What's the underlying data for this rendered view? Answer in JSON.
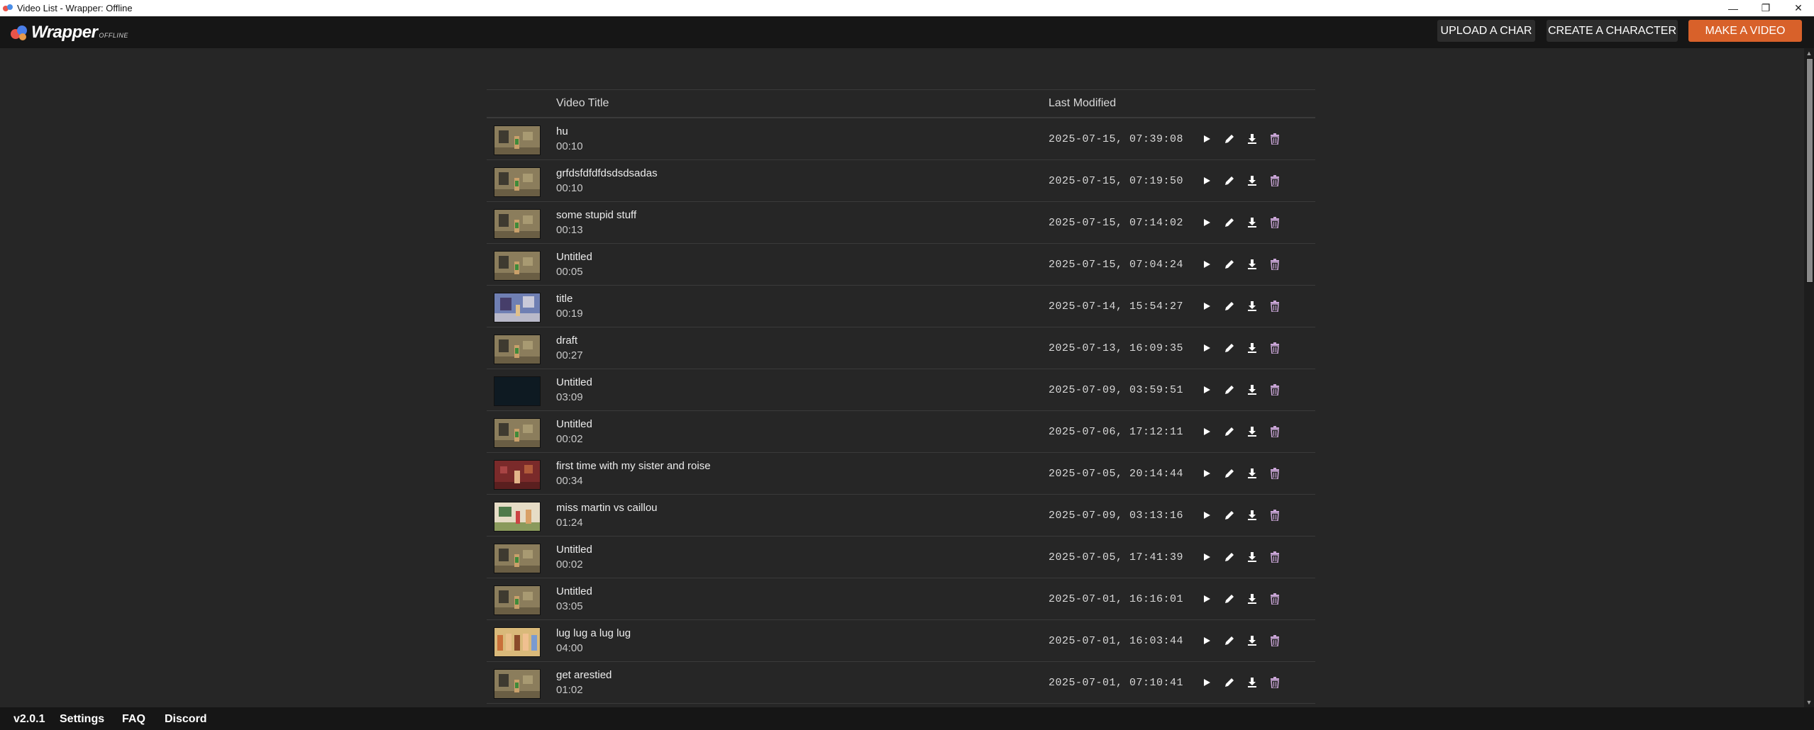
{
  "window": {
    "title": "Video List - Wrapper: Offline",
    "controls": {
      "minimize": "—",
      "maximize": "❐",
      "close": "✕"
    }
  },
  "header": {
    "logo_text": "Wrapper",
    "logo_sub": "OFFLINE",
    "buttons": {
      "upload": "UPLOAD A CHAR",
      "create": "CREATE A CHARACTER",
      "make": "MAKE A VIDEO"
    },
    "accent_color": "#d8612a"
  },
  "table": {
    "col_title": "Video Title",
    "col_modified": "Last Modified",
    "rows": [
      {
        "title": "hu",
        "duration": "00:10",
        "modified": "2025-07-15, 07:39:08",
        "thumb": "room"
      },
      {
        "title": "grfdsfdfdfdsdsdsadas",
        "duration": "00:10",
        "modified": "2025-07-15, 07:19:50",
        "thumb": "room"
      },
      {
        "title": "some stupid stuff",
        "duration": "00:13",
        "modified": "2025-07-15, 07:14:02",
        "thumb": "room"
      },
      {
        "title": "Untitled",
        "duration": "00:05",
        "modified": "2025-07-15, 07:04:24",
        "thumb": "room"
      },
      {
        "title": "title",
        "duration": "00:19",
        "modified": "2025-07-14, 15:54:27",
        "thumb": "blue"
      },
      {
        "title": "draft",
        "duration": "00:27",
        "modified": "2025-07-13, 16:09:35",
        "thumb": "room"
      },
      {
        "title": "Untitled",
        "duration": "03:09",
        "modified": "2025-07-09, 03:59:51",
        "thumb": "dark"
      },
      {
        "title": "Untitled",
        "duration": "00:02",
        "modified": "2025-07-06, 17:12:11",
        "thumb": "room"
      },
      {
        "title": "first time with my sister and roise",
        "duration": "00:34",
        "modified": "2025-07-05, 20:14:44",
        "thumb": "red"
      },
      {
        "title": "miss martin vs caillou",
        "duration": "01:24",
        "modified": "2025-07-09, 03:13:16",
        "thumb": "class"
      },
      {
        "title": "Untitled",
        "duration": "00:02",
        "modified": "2025-07-05, 17:41:39",
        "thumb": "room"
      },
      {
        "title": "Untitled",
        "duration": "03:05",
        "modified": "2025-07-01, 16:16:01",
        "thumb": "room"
      },
      {
        "title": "lug lug a lug lug",
        "duration": "04:00",
        "modified": "2025-07-01, 16:03:44",
        "thumb": "crowd"
      },
      {
        "title": "get arestied",
        "duration": "01:02",
        "modified": "2025-07-01, 07:10:41",
        "thumb": "room"
      }
    ],
    "action_icons": [
      "play-icon",
      "edit-icon",
      "download-icon",
      "trash-icon"
    ],
    "trash_color": "#c9a5d6"
  },
  "footer": {
    "version": "v2.0.1",
    "settings": "Settings",
    "faq": "FAQ",
    "discord": "Discord"
  }
}
